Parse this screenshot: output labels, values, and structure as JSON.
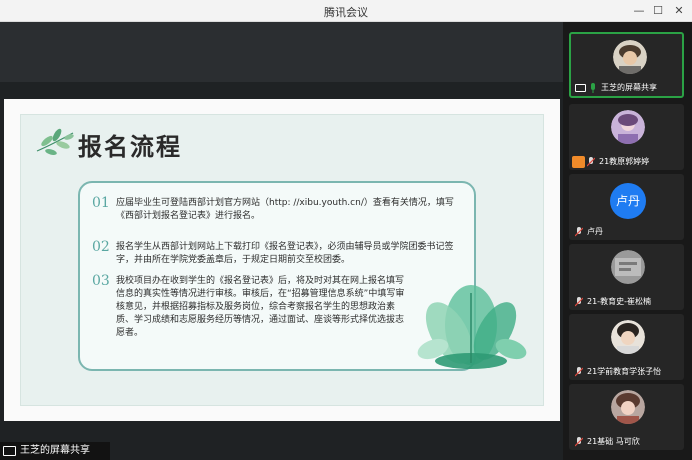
{
  "window": {
    "title": "腾讯会议",
    "controls": {
      "minimize": "—",
      "maximize": "☐",
      "close": "✕"
    }
  },
  "slide": {
    "title": "报名流程",
    "items": [
      {
        "num": "01",
        "text": "应届毕业生可登陆西部计划官方网站（http: //xibu.youth.cn/）查看有关情况，填写《西部计划报名登记表》进行报名。"
      },
      {
        "num": "02",
        "text": "报名学生从西部计划网站上下载打印《报名登记表》，必须由辅导员或学院团委书记签字，并由所在学院党委盖章后，于规定日期前交至校团委。"
      },
      {
        "num": "03",
        "text": "我校项目办在收到学生的《报名登记表》后，将及时对其在网上报名填写信息的真实性等情况进行审核。审核后，在“招募管理信息系统”中填写审核意见，并根据招募指标及服务岗位，综合考察报名学生的思想政治素质、学习成绩和志愿服务经历等情况，通过面试、座谈等形式择优选拔志愿者。"
      }
    ]
  },
  "share_label": "王芝的屏幕共享",
  "participants": [
    {
      "name": "王芝的屏幕共享",
      "avatar": "photo",
      "active": true,
      "screen_share": true
    },
    {
      "name": "21教原郭婷婷",
      "avatar": "photo",
      "badge": "orange"
    },
    {
      "name": "卢丹",
      "avatar": "text",
      "avatar_text": "卢丹"
    },
    {
      "name": "21-教育史-崔松楠",
      "avatar": "photo"
    },
    {
      "name": "21学前教育学张子怡",
      "avatar": "photo"
    },
    {
      "name": "21基础 马可欣",
      "avatar": "photo"
    }
  ],
  "colors": {
    "accent": "#2ba245",
    "slide_teal": "#5aa7a2",
    "avatar_blue": "#1f7cf2"
  }
}
